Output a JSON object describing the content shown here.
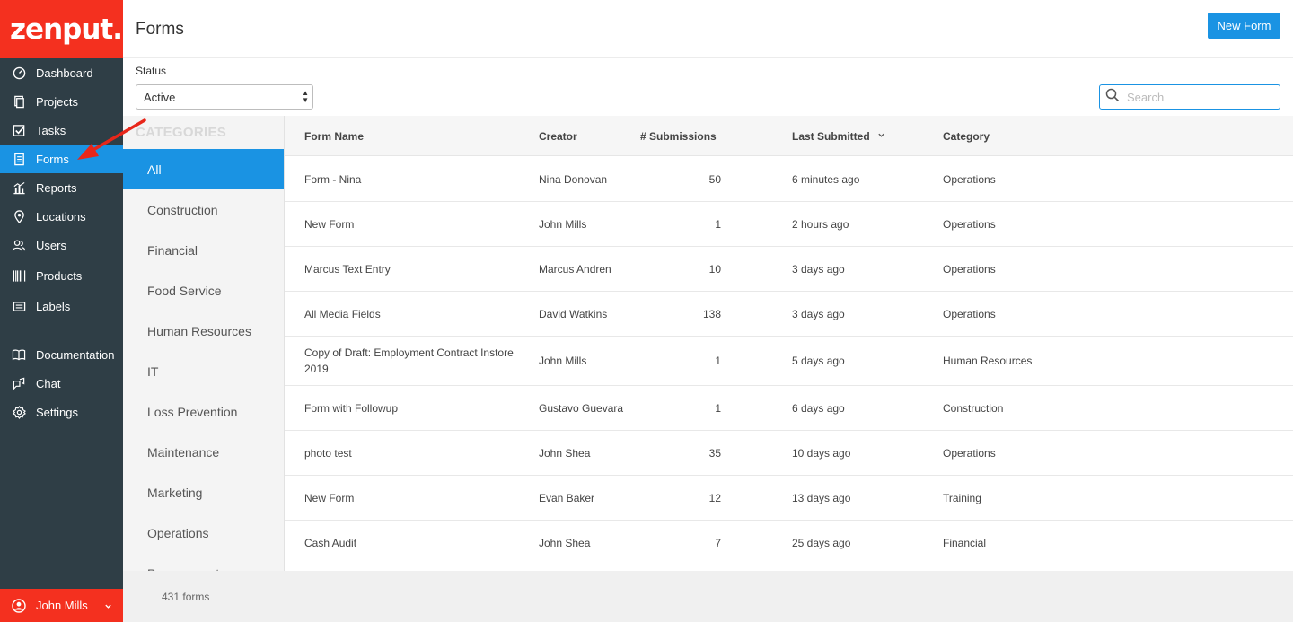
{
  "brand": {
    "logo_text": "zenput."
  },
  "sidebar": {
    "items": [
      {
        "label": "Dashboard",
        "icon": "dashboard-icon"
      },
      {
        "label": "Projects",
        "icon": "projects-icon"
      },
      {
        "label": "Tasks",
        "icon": "tasks-icon"
      },
      {
        "label": "Forms",
        "icon": "forms-icon",
        "active": true
      },
      {
        "label": "Reports",
        "icon": "reports-icon"
      },
      {
        "label": "Locations",
        "icon": "location-pin-icon"
      },
      {
        "label": "Users",
        "icon": "users-icon"
      },
      {
        "label": "Products",
        "icon": "barcode-icon"
      },
      {
        "label": "Labels",
        "icon": "labels-icon"
      },
      {
        "label": "Documentation",
        "icon": "book-icon"
      },
      {
        "label": "Chat",
        "icon": "chat-icon"
      },
      {
        "label": "Settings",
        "icon": "gear-icon"
      }
    ],
    "user": {
      "name": "John Mills"
    }
  },
  "header": {
    "title": "Forms",
    "new_form_label": "New Form"
  },
  "filters": {
    "status_label": "Status",
    "status_value": "Active",
    "search_placeholder": "Search"
  },
  "categories": {
    "heading": "CATEGORIES",
    "items": [
      "All",
      "Construction",
      "Financial",
      "Food Service",
      "Human Resources",
      "IT",
      "Loss Prevention",
      "Maintenance",
      "Marketing",
      "Operations",
      "Procurement"
    ],
    "selected": "All"
  },
  "table": {
    "columns": [
      "Form Name",
      "Creator",
      "# Submissions",
      "Last Submitted",
      "Category"
    ],
    "sort_column": "Last Submitted",
    "rows": [
      {
        "name": "Form - Nina",
        "creator": "Nina Donovan",
        "submissions": "50",
        "last": "6 minutes ago",
        "category": "Operations"
      },
      {
        "name": "New Form",
        "creator": "John Mills",
        "submissions": "1",
        "last": "2 hours ago",
        "category": "Operations"
      },
      {
        "name": "Marcus Text Entry",
        "creator": "Marcus Andren",
        "submissions": "10",
        "last": "3 days ago",
        "category": "Operations"
      },
      {
        "name": "All Media Fields",
        "creator": "David Watkins",
        "submissions": "138",
        "last": "3 days ago",
        "category": "Operations"
      },
      {
        "name": "Copy of Draft: Employment Contract Instore 2019",
        "creator": "John Mills",
        "submissions": "1",
        "last": "5 days ago",
        "category": "Human Resources"
      },
      {
        "name": "Form with Followup",
        "creator": "Gustavo Guevara",
        "submissions": "1",
        "last": "6 days ago",
        "category": "Construction"
      },
      {
        "name": "photo test",
        "creator": "John Shea",
        "submissions": "35",
        "last": "10 days ago",
        "category": "Operations"
      },
      {
        "name": "New Form",
        "creator": "Evan Baker",
        "submissions": "12",
        "last": "13 days ago",
        "category": "Training"
      },
      {
        "name": "Cash Audit",
        "creator": "John Shea",
        "submissions": "7",
        "last": "25 days ago",
        "category": "Financial"
      }
    ]
  },
  "footer": {
    "count_text": "431 forms"
  },
  "colors": {
    "brand_red": "#f4301f",
    "sidebar_bg": "#2f3e46",
    "accent_blue": "#1a93e3",
    "annotation_red": "#e8261a"
  }
}
